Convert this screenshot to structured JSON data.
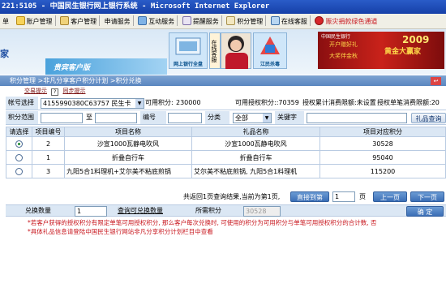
{
  "window": {
    "title": "221:5105 - 中国民生银行网上银行系统 - Microsoft Internet Explorer"
  },
  "menu": [
    {
      "label": "单",
      "icon": ""
    },
    {
      "label": "账户管理",
      "icon": "account-icon"
    },
    {
      "label": "客户管理",
      "icon": "customer-icon"
    },
    {
      "label": "申请服务",
      "icon": ""
    },
    {
      "label": "互动服务",
      "icon": "interactive-icon"
    },
    {
      "label": "提醒服务",
      "icon": "reminder-icon"
    },
    {
      "label": "积分管理",
      "icon": "points-icon"
    },
    {
      "label": "在线客服",
      "icon": "online-service-icon"
    },
    {
      "label": "赈灾捐款绿色通道",
      "icon": "donation-icon"
    }
  ],
  "banner": {
    "home_label": "家",
    "vip_label": "贵宾客户版",
    "promo1": "网上银行全盘",
    "promo2": "在线客服",
    "promo4": "江民杀毒",
    "ad": {
      "logo": "中国民生银行",
      "line1": "开户赠好礼",
      "line2": "大奖伴金秋",
      "year": "2009",
      "line3": "黄金大赢家"
    }
  },
  "breadcrumb": "积分管理 >非凡分享客户积分计划 >积分兑换",
  "helpbar": {
    "link1": "交易提示",
    "q": "?",
    "link2": "同步提示"
  },
  "form": {
    "account_label": "帐号选择",
    "account_value": "4155990380C63757 民生卡",
    "available_points_label": "可用积分:",
    "available_points_value": "230000",
    "authorized_points_label": "可用授权积分::70359",
    "authorized_consumed_label": "授权累计消费限额:未设置",
    "authorized_single_label": "授权单笔消费限额:20",
    "range_label": "积分范围",
    "range_to": "至",
    "code_label": "编号",
    "category_label": "分类",
    "category_value": "全部",
    "keyword_label": "关键字",
    "query_button": "礼品查询"
  },
  "table": {
    "headers": [
      "请选择",
      "项目编号",
      "项目名称",
      "礼品名称",
      "项目对应积分"
    ],
    "rows": [
      {
        "selected": true,
        "id": "2",
        "project": "沙宣1000瓦静电吹风",
        "gift": "沙宣1000瓦静电吹风",
        "points": "30528"
      },
      {
        "selected": false,
        "id": "1",
        "project": "折叠自行车",
        "gift": "折叠自行车",
        "points": "95040"
      },
      {
        "selected": false,
        "id": "3",
        "project": "九阳5合1料理机+艾尔美不粘底煎锅",
        "gift": "艾尔美不粘底煎锅, 九阳5合1料理机",
        "points": "115200"
      }
    ]
  },
  "pager": {
    "summary": "共返回1页查询结果,当前为第1页,",
    "goto_button": "直接到第",
    "page_value": "1",
    "page_suffix": "页",
    "prev_button": "上一页",
    "next_button": "下一页"
  },
  "exchange": {
    "qty_label": "兑换数量",
    "qty_value": "1",
    "query_qty_label": "查询可兑换数量",
    "required_label": "所需积分",
    "required_value": "30528",
    "confirm_button": "确 定"
  },
  "notes": [
    "*若客户获得的授权积分有限定单笔可用授权积分, 那么客户每次兑换时, 可使用的积分为可用积分与单笔可用授权积分的合计数, 否",
    "*具体礼品信息请登陆中国民生银行网站非凡分享积分计划栏目中查看"
  ]
}
